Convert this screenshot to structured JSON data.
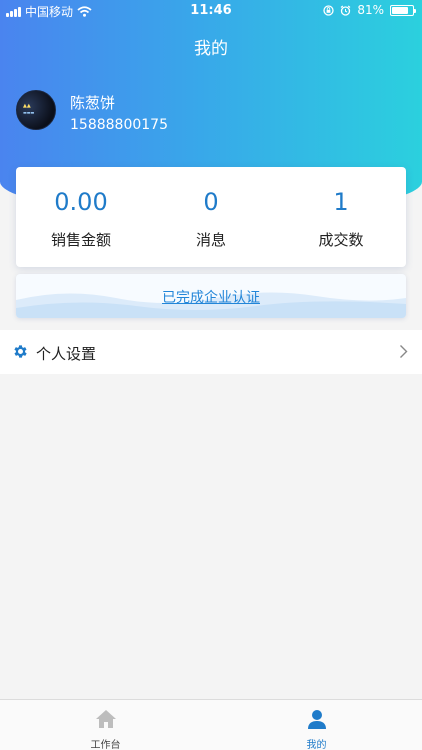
{
  "status_bar": {
    "carrier": "中国移动",
    "time": "11:46",
    "battery": "81%",
    "battery_level": 0.81
  },
  "header": {
    "title": "我的"
  },
  "profile": {
    "name": "陈葱饼",
    "phone": "15888800175"
  },
  "stats": [
    {
      "value": "0.00",
      "label": "销售金额"
    },
    {
      "value": "0",
      "label": "消息"
    },
    {
      "value": "1",
      "label": "成交数"
    }
  ],
  "certification": {
    "link_text": "已完成企业认证"
  },
  "settings": {
    "label": "个人设置"
  },
  "tabbar": {
    "items": [
      {
        "label": "工作台",
        "icon": "home-icon",
        "active": false
      },
      {
        "label": "我的",
        "icon": "user-icon",
        "active": true
      }
    ]
  },
  "colors": {
    "gradient_start": "#4a84ef",
    "gradient_end": "#2bd0de",
    "accent": "#1f7bc9",
    "link": "#2386d8"
  }
}
